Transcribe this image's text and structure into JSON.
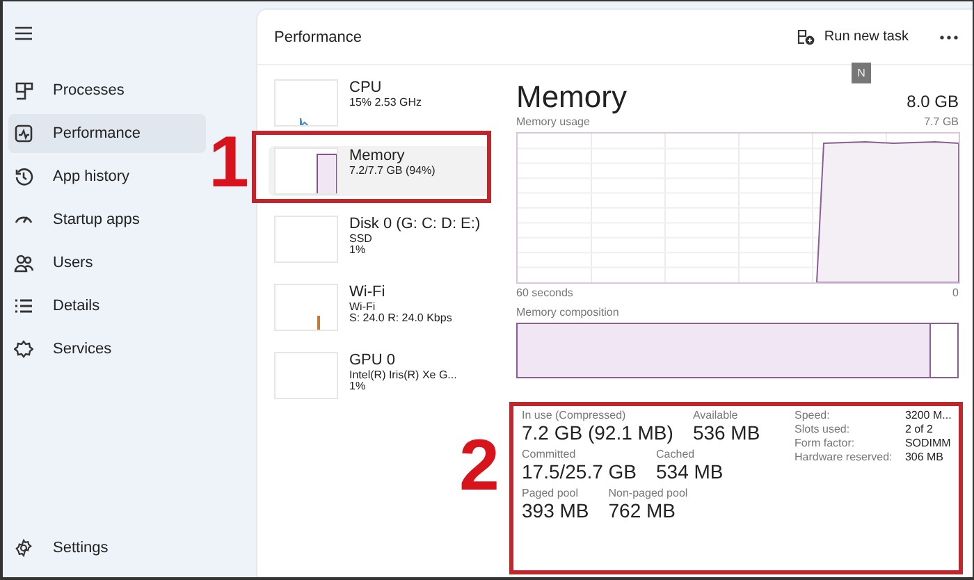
{
  "sidebar": {
    "items": [
      {
        "label": "Processes",
        "kind": "processes",
        "selected": false
      },
      {
        "label": "Performance",
        "kind": "performance",
        "selected": true
      },
      {
        "label": "App history",
        "kind": "history",
        "selected": false
      },
      {
        "label": "Startup apps",
        "kind": "startup",
        "selected": false
      },
      {
        "label": "Users",
        "kind": "users",
        "selected": false
      },
      {
        "label": "Details",
        "kind": "details",
        "selected": false
      },
      {
        "label": "Services",
        "kind": "services",
        "selected": false
      }
    ],
    "settings": "Settings"
  },
  "header": {
    "title": "Performance",
    "run_task": "Run new task"
  },
  "badge": "N",
  "devices": [
    {
      "name": "CPU",
      "kind": "cpu",
      "lines": [
        "15% 2.53 GHz"
      ],
      "selected": false
    },
    {
      "name": "Memory",
      "kind": "memory",
      "lines": [
        "7.2/7.7 GB (94%)"
      ],
      "selected": true
    },
    {
      "name": "Disk 0 (G: C: D: E:)",
      "kind": "disk",
      "lines": [
        "SSD",
        "1%"
      ],
      "selected": false
    },
    {
      "name": "Wi-Fi",
      "kind": "wifi",
      "lines": [
        "Wi-Fi",
        "S: 24.0 R: 24.0 Kbps"
      ],
      "selected": false
    },
    {
      "name": "GPU 0",
      "kind": "gpu",
      "lines": [
        "Intel(R) Iris(R) Xe G...",
        "1%"
      ],
      "selected": false
    }
  ],
  "detail": {
    "title": "Memory",
    "total": "8.0 GB",
    "usage_label": "Memory usage",
    "usage_max": "7.7 GB",
    "time_label": "60 seconds",
    "time_end": "0",
    "composition": {
      "label": "Memory composition",
      "level": 0.94
    },
    "stat_rows": [
      [
        {
          "label": "In use (Compressed)",
          "value": "7.2 GB (92.1 MB)"
        },
        {
          "label": "Available",
          "value": "536 MB"
        }
      ],
      [
        {
          "label": "Committed",
          "value": "17.5/25.7 GB"
        },
        {
          "label": "Cached",
          "value": "534 MB"
        }
      ],
      [
        {
          "label": "Paged pool",
          "value": "393 MB"
        },
        {
          "label": "Non-paged pool",
          "value": "762 MB"
        }
      ]
    ],
    "properties": [
      {
        "key": "Speed:",
        "value": "3200 M..."
      },
      {
        "key": "Slots used:",
        "value": "2 of 2"
      },
      {
        "key": "Form factor:",
        "value": "SODIMM"
      },
      {
        "key": "Hardware reserved:",
        "value": "306 MB"
      }
    ]
  },
  "annotations": [
    {
      "label": "1"
    },
    {
      "label": "2"
    }
  ]
}
